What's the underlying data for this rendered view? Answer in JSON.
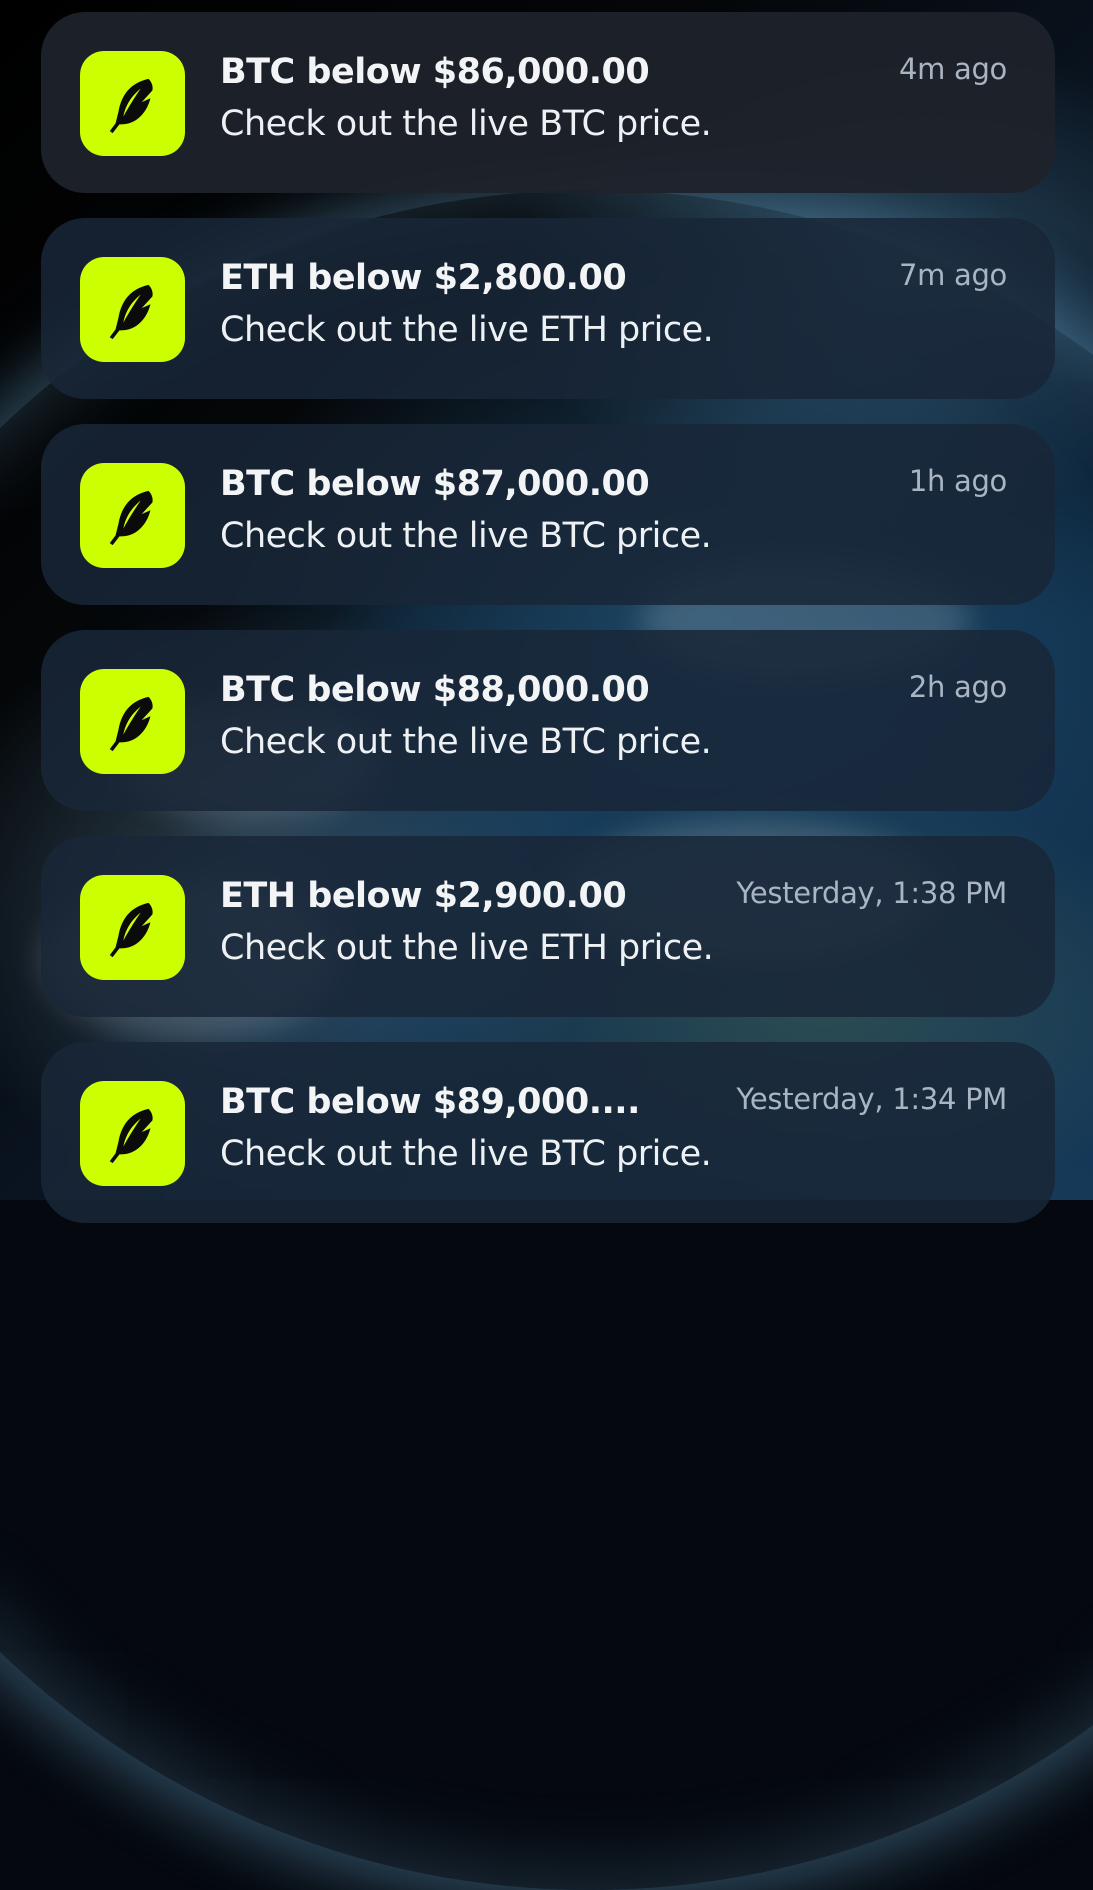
{
  "notifications": [
    {
      "app_icon": "robinhood-feather-icon",
      "title": "BTC below $86,000.00",
      "body": "Check out the live BTC price.",
      "time": "4m ago"
    },
    {
      "app_icon": "robinhood-feather-icon",
      "title": "ETH below $2,800.00",
      "body": "Check out the live ETH price.",
      "time": "7m ago"
    },
    {
      "app_icon": "robinhood-feather-icon",
      "title": "BTC below $87,000.00",
      "body": "Check out the live BTC price.",
      "time": "1h ago"
    },
    {
      "app_icon": "robinhood-feather-icon",
      "title": "BTC below $88,000.00",
      "body": "Check out the live BTC price.",
      "time": "2h ago"
    },
    {
      "app_icon": "robinhood-feather-icon",
      "title": "ETH below $2,900.00",
      "body": "Check out the live ETH price.",
      "time": "Yesterday, 1:38 PM"
    },
    {
      "app_icon": "robinhood-feather-icon",
      "title": "BTC below $89,000....",
      "body": "Check out the live BTC price.",
      "time": "Yesterday, 1:34 PM"
    }
  ],
  "colors": {
    "app_icon_background": "#ccff00",
    "app_icon_glyph": "#0b0b0b"
  }
}
